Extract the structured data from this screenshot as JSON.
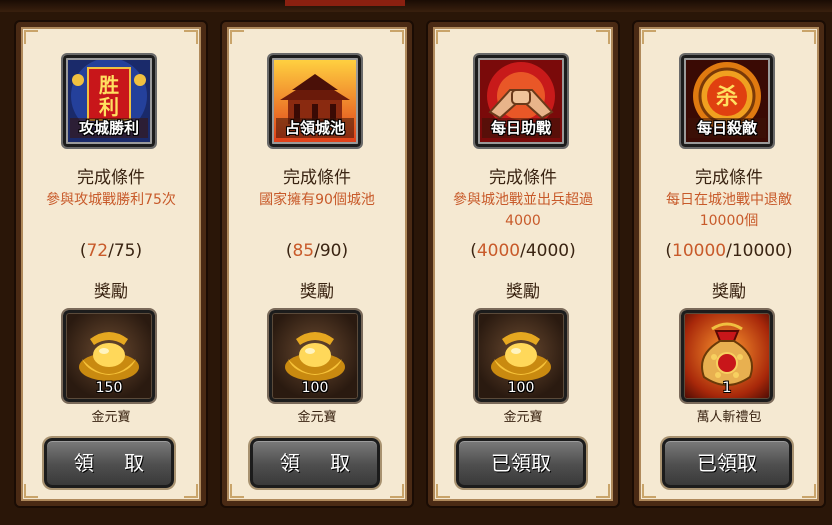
{
  "labels": {
    "condition_title": "完成條件",
    "reward_title": "獎勵"
  },
  "colors": {
    "condition_text": "#c85a2a",
    "progress_current": "#c85a2a",
    "card_background": "#f5e9d2",
    "card_border": "#4a2a14",
    "button": "#555555"
  },
  "tasks": [
    {
      "badge_icon": "victory-banner-icon",
      "badge_label": "攻城勝利",
      "condition": "參與攻城戰勝利75次",
      "progress_current": "72",
      "progress_total": "75",
      "reward_icon": "gold-ingot-icon",
      "reward_qty": "150",
      "reward_name": "金元寶",
      "button_label": "領 取"
    },
    {
      "badge_icon": "ancient-palace-icon",
      "badge_label": "占領城池",
      "condition": "國家擁有90個城池",
      "progress_current": "85",
      "progress_total": "90",
      "reward_icon": "gold-ingot-icon",
      "reward_qty": "100",
      "reward_name": "金元寶",
      "button_label": "領 取"
    },
    {
      "badge_icon": "clasped-hands-icon",
      "badge_label": "每日助戰",
      "condition": "參與城池戰並出兵超過4000",
      "progress_current": "4000",
      "progress_total": "4000",
      "reward_icon": "gold-ingot-icon",
      "reward_qty": "100",
      "reward_name": "金元寶",
      "button_label": "已領取"
    },
    {
      "badge_icon": "kill-emblem-icon",
      "badge_label": "每日殺敵",
      "emblem_glyph": "杀",
      "condition": "每日在城池戰中退敵10000個",
      "progress_current": "10000",
      "progress_total": "10000",
      "reward_icon": "gift-bag-icon",
      "reward_qty": "1",
      "reward_name": "萬人斬禮包",
      "button_label": "已領取"
    }
  ]
}
